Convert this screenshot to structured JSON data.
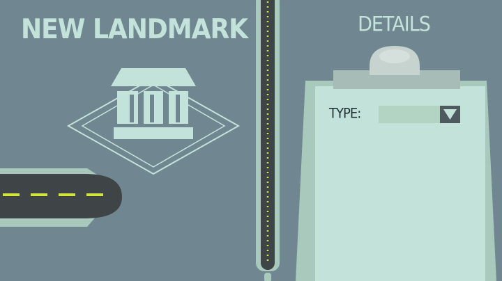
{
  "screen": {
    "title": "NEW LANDMARK",
    "details_title": "DETAILS"
  },
  "form": {
    "type_label": "TYPE:",
    "type_value": ""
  },
  "colors": {
    "background": "#708791",
    "accent_light": "#c3e3da",
    "road": "#3f4446",
    "road_marking": "#d2e63d",
    "select_fill": "#b3d4c2",
    "select_button": "#4e5a5e"
  },
  "icons": {
    "landmark": "bank-building-icon",
    "dropdown": "triangle-down-icon"
  }
}
